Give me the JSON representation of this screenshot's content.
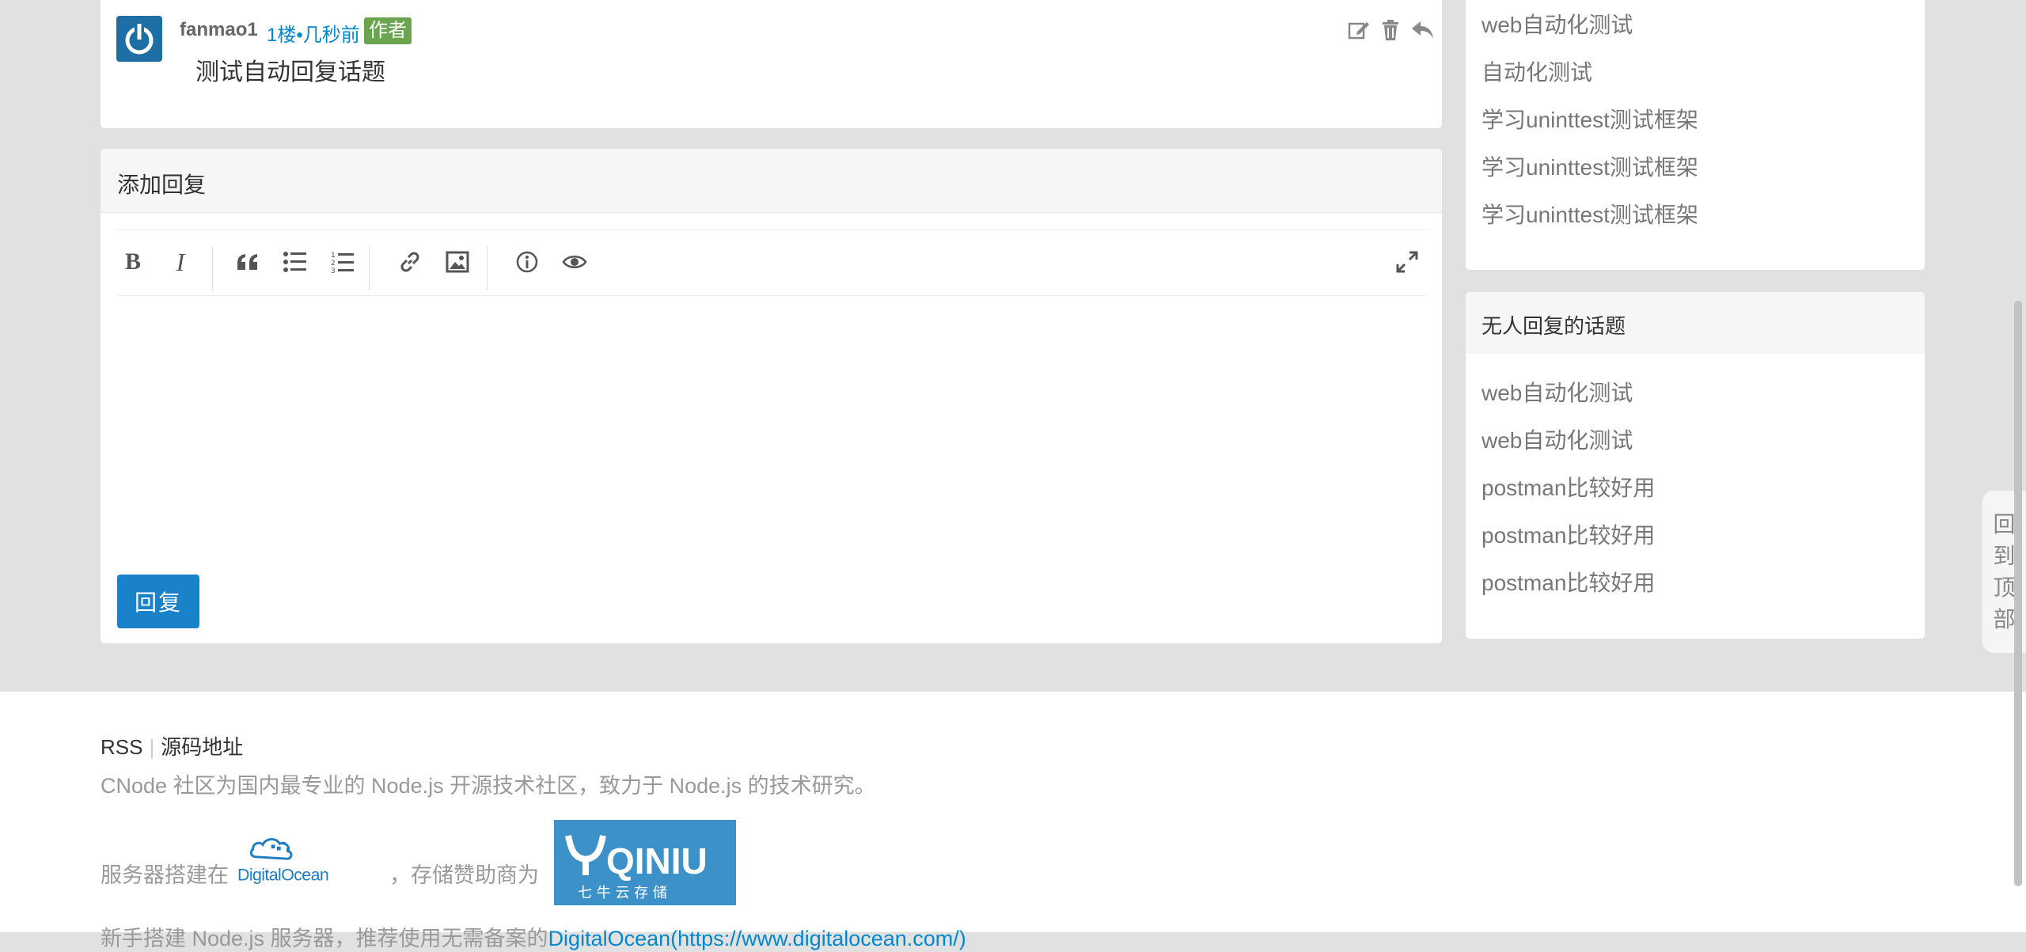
{
  "reply": {
    "author": "fanmao1",
    "meta": "1楼•几秒前",
    "badge": "作者",
    "content": "测试自动回复话题",
    "actions": [
      "edit-icon",
      "trash-icon",
      "reply-icon"
    ]
  },
  "editor": {
    "header": "添加回复",
    "toolbar": [
      "bold",
      "italic",
      "quote",
      "unordered-list",
      "ordered-list",
      "link",
      "image",
      "info",
      "preview",
      "fullscreen"
    ],
    "submit_label": "回复"
  },
  "sidebar": {
    "topics_top": [
      "web自动化测试",
      "自动化测试",
      "学习uninttest测试框架",
      "学习uninttest测试框架",
      "学习uninttest测试框架"
    ],
    "no_reply_title": "无人回复的话题",
    "no_reply": [
      "web自动化测试",
      "web自动化测试",
      "postman比较好用",
      "postman比较好用",
      "postman比较好用"
    ]
  },
  "back_to_top": [
    "回",
    "到",
    "顶",
    "部"
  ],
  "footer": {
    "rss": "RSS",
    "source": "源码地址",
    "description": "CNode 社区为国内最专业的 Node.js 开源技术社区，致力于 Node.js 的技术研究。",
    "server_text": "服务器搭建在",
    "digitalocean_logo_text": "DigitalOcean",
    "storage_text": "，存储赞助商为",
    "qiniu_logo_text": "QINIU",
    "qiniu_sub": "七 牛 云 存 储",
    "cut_text": "新手搭建 Node.js 服务器，推荐使用无需备案的",
    "cut_link": "DigitalOcean(https://www.digitalocean.com/)"
  }
}
